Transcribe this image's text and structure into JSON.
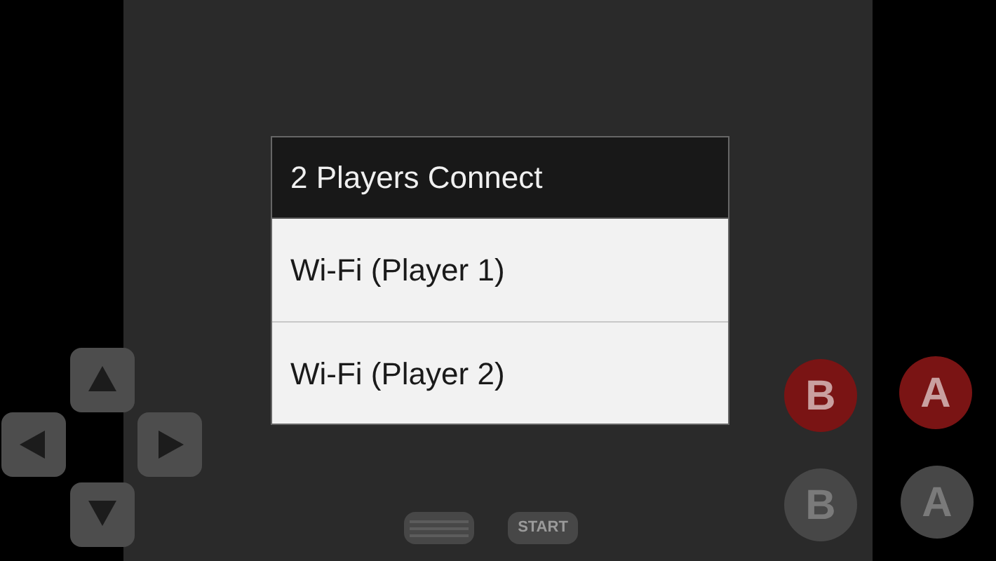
{
  "dialog": {
    "title": "2 Players Connect",
    "items": [
      {
        "label": "Wi-Fi (Player 1)"
      },
      {
        "label": "Wi-Fi (Player 2)"
      }
    ]
  },
  "buttons": [
    {
      "label": "B",
      "kind": "red"
    },
    {
      "label": "A",
      "kind": "red"
    },
    {
      "label": "B",
      "kind": "gray"
    },
    {
      "label": "A",
      "kind": "gray"
    }
  ],
  "start_button": "START"
}
